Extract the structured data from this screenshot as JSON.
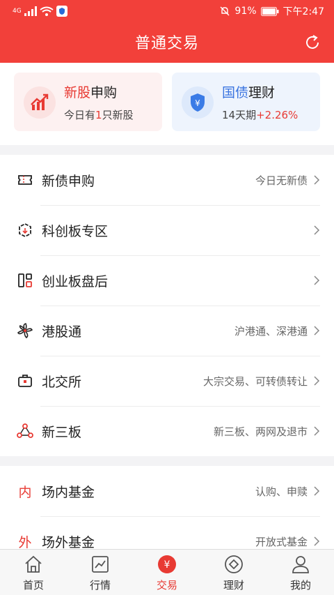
{
  "status": {
    "network": "4G",
    "battery": "91%",
    "time": "下午2:47"
  },
  "header": {
    "title": "普通交易"
  },
  "cards": [
    {
      "title_a": "新股",
      "title_b": "申购",
      "sub_a": "今日有",
      "sub_num": "1",
      "sub_b": "只新股"
    },
    {
      "title_a": "国债",
      "title_b": "理财",
      "sub_a": "14天期",
      "sub_rate": "+2.26%"
    }
  ],
  "group1": [
    {
      "label": "新债申购",
      "right": "今日无新债",
      "icon": "bond-ticket-icon"
    },
    {
      "label": "科创板专区",
      "right": "",
      "icon": "cube-icon"
    },
    {
      "label": "创业板盘后",
      "right": "",
      "icon": "columns-icon"
    },
    {
      "label": "港股通",
      "right": "沪港通、深港通",
      "icon": "bauhinia-icon"
    },
    {
      "label": "北交所",
      "right": "大宗交易、可转债转让",
      "icon": "briefcase-icon"
    },
    {
      "label": "新三板",
      "right": "新三板、两网及退市",
      "icon": "triangle-nodes-icon"
    }
  ],
  "group2": [
    {
      "glyph": "内",
      "label": "场内基金",
      "right": "认购、申赎"
    },
    {
      "glyph": "外",
      "label": "场外基金",
      "right": "开放式基金"
    }
  ],
  "tabs": [
    {
      "label": "首页",
      "icon": "home-icon"
    },
    {
      "label": "行情",
      "icon": "chart-icon"
    },
    {
      "label": "交易",
      "icon": "yuan-icon"
    },
    {
      "label": "理财",
      "icon": "diamond-icon"
    },
    {
      "label": "我的",
      "icon": "user-icon"
    }
  ],
  "colors": {
    "brand": "#f2403a",
    "accent_red": "#e83a33",
    "accent_blue": "#3a74e0"
  }
}
